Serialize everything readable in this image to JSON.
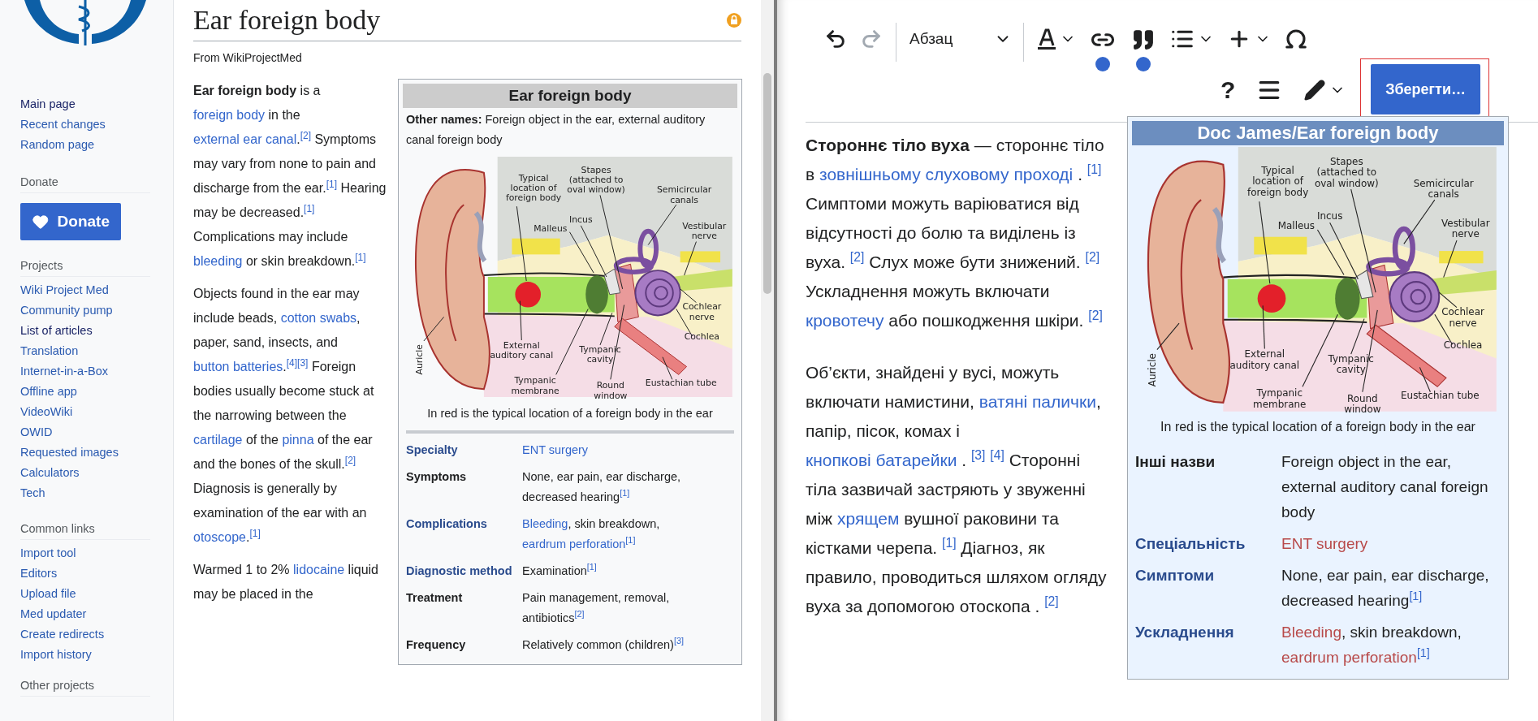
{
  "sidebar": {
    "main_links": [
      {
        "label": "Main page",
        "visited": true
      },
      {
        "label": "Recent changes",
        "visited": false
      },
      {
        "label": "Random page",
        "visited": false
      }
    ],
    "donate": {
      "heading": "Donate",
      "button": "Donate"
    },
    "sections": [
      {
        "heading": "Projects",
        "items": [
          {
            "label": "Wiki Project Med",
            "visited": false
          },
          {
            "label": "Community pump",
            "visited": false
          },
          {
            "label": "List of articles",
            "visited": true
          },
          {
            "label": "Translation",
            "visited": false
          },
          {
            "label": "Internet-in-a-Box",
            "visited": false
          },
          {
            "label": "Offline app",
            "visited": false
          },
          {
            "label": "VideoWiki",
            "visited": false
          },
          {
            "label": "OWID",
            "visited": false
          },
          {
            "label": "Requested images",
            "visited": false
          },
          {
            "label": "Calculators",
            "visited": false
          },
          {
            "label": "Tech",
            "visited": false
          }
        ]
      },
      {
        "heading": "Common links",
        "items": [
          {
            "label": "Import tool",
            "visited": false
          },
          {
            "label": "Editors",
            "visited": false
          },
          {
            "label": "Upload file",
            "visited": false
          },
          {
            "label": "Med updater",
            "visited": false
          },
          {
            "label": "Create redirects",
            "visited": false
          },
          {
            "label": "Import history",
            "visited": false
          }
        ]
      },
      {
        "heading": "Other projects"
      }
    ]
  },
  "article": {
    "title": "Ear foreign body",
    "subtitle": "From WikiProjectMed",
    "paragraphs": [
      [
        {
          "kind": "bold",
          "text": "Ear foreign body"
        },
        {
          "kind": "text",
          "text": " is a "
        },
        {
          "kind": "link",
          "text": "foreign body"
        },
        {
          "kind": "text",
          "text": " in the "
        },
        {
          "kind": "link",
          "text": "external ear canal"
        },
        {
          "kind": "text",
          "text": "."
        },
        {
          "kind": "ref",
          "text": "[2]"
        },
        {
          "kind": "text",
          "text": " Symptoms may vary from none to pain and discharge from the ear."
        },
        {
          "kind": "ref",
          "text": "[1]"
        },
        {
          "kind": "text",
          "text": " Hearing may be decreased."
        },
        {
          "kind": "ref",
          "text": "[1]"
        },
        {
          "kind": "text",
          "text": " Complications may include "
        },
        {
          "kind": "link",
          "text": "bleeding"
        },
        {
          "kind": "text",
          "text": " or skin breakdown."
        },
        {
          "kind": "ref",
          "text": "[1]"
        }
      ],
      [
        {
          "kind": "text",
          "text": "Objects found in the ear may include beads, "
        },
        {
          "kind": "link",
          "text": "cotton swabs"
        },
        {
          "kind": "text",
          "text": ", paper, sand, insects, and "
        },
        {
          "kind": "link",
          "text": "button batteries"
        },
        {
          "kind": "text",
          "text": "."
        },
        {
          "kind": "ref",
          "text": "[4]"
        },
        {
          "kind": "ref",
          "text": "[3]"
        },
        {
          "kind": "text",
          "text": " Foreign bodies usually become stuck at the narrowing between the "
        },
        {
          "kind": "link",
          "text": "cartilage"
        },
        {
          "kind": "text",
          "text": " of the "
        },
        {
          "kind": "link",
          "text": "pinna"
        },
        {
          "kind": "text",
          "text": " of the ear and the bones of the skull."
        },
        {
          "kind": "ref",
          "text": "[2]"
        },
        {
          "kind": "text",
          "text": " Diagnosis is generally by examination of the ear with an "
        },
        {
          "kind": "link",
          "text": "otoscope"
        },
        {
          "kind": "text",
          "text": "."
        },
        {
          "kind": "ref",
          "text": "[1]"
        }
      ],
      [
        {
          "kind": "text",
          "text": "Warmed 1 to 2% "
        },
        {
          "kind": "link",
          "text": "lidocaine"
        },
        {
          "kind": "text",
          "text": " liquid may be placed in the"
        }
      ]
    ],
    "infobox": {
      "title": "Ear foreign body",
      "other_names": {
        "label": "Other names:",
        "value": "Foreign object in the ear, external auditory canal foreign body"
      },
      "image": {
        "labels": [
          {
            "lines": [
              "Typical",
              "location of",
              "foreign body"
            ]
          },
          {
            "lines": [
              "Stapes",
              "(attached to",
              "oval window)"
            ]
          },
          {
            "lines": [
              "Semicircular",
              "canals"
            ]
          },
          {
            "lines": [
              "Incus"
            ]
          },
          {
            "lines": [
              "Malleus"
            ]
          },
          {
            "lines": [
              "Vestibular",
              "nerve"
            ]
          },
          {
            "lines": [
              "Cochlear",
              "nerve"
            ]
          },
          {
            "lines": [
              "Cochlea"
            ]
          },
          {
            "lines": [
              "External",
              "auditory canal"
            ]
          },
          {
            "lines": [
              "Tympanic",
              "cavity"
            ]
          },
          {
            "lines": [
              "Auricle"
            ]
          },
          {
            "lines": [
              "Tympanic",
              "membrane"
            ]
          },
          {
            "lines": [
              "Round",
              "window"
            ]
          },
          {
            "lines": [
              "Eustachian tube"
            ]
          }
        ]
      },
      "caption": "In red is the typical location of a foreign body in the ear",
      "rows": [
        {
          "label": "Specialty",
          "label_is_link": true,
          "value": [
            {
              "kind": "link",
              "text": "ENT surgery"
            }
          ]
        },
        {
          "label": "Symptoms",
          "label_is_link": false,
          "value": [
            {
              "kind": "text",
              "text": "None, ear pain, ear discharge, decreased hearing"
            },
            {
              "kind": "ref",
              "text": "[1]"
            }
          ]
        },
        {
          "label": "Complications",
          "label_is_link": true,
          "value": [
            {
              "kind": "link",
              "text": "Bleeding"
            },
            {
              "kind": "text",
              "text": ", skin breakdown, "
            },
            {
              "kind": "link",
              "text": "eardrum perforation"
            },
            {
              "kind": "ref",
              "text": "[1]"
            }
          ]
        },
        {
          "label": "Diagnostic method",
          "label_is_link": true,
          "value": [
            {
              "kind": "text",
              "text": "Examination"
            },
            {
              "kind": "ref",
              "text": "[1]"
            }
          ]
        },
        {
          "label": "Treatment",
          "label_is_link": false,
          "value": [
            {
              "kind": "text",
              "text": "Pain management, removal, antibiotics"
            },
            {
              "kind": "ref",
              "text": "[2]"
            }
          ]
        },
        {
          "label": "Frequency",
          "label_is_link": false,
          "value": [
            {
              "kind": "text",
              "text": "Relatively common (children)"
            },
            {
              "kind": "ref",
              "text": "[3]"
            }
          ]
        }
      ]
    }
  },
  "editor": {
    "toolbar": {
      "undo": {
        "disabled": false
      },
      "redo": {
        "disabled": true
      },
      "format": "Абзац",
      "help": "?",
      "save": "Зберегти…"
    },
    "paragraphs": [
      [
        {
          "kind": "bold",
          "text": "Стороннє тіло вуха"
        },
        {
          "kind": "text",
          "text": " — стороннє тіло в "
        },
        {
          "kind": "link",
          "text": "зовнішньому слуховому"
        },
        {
          "kind": "link",
          "text": "проході",
          "space_before": true
        },
        {
          "kind": "text",
          "text": " . "
        },
        {
          "kind": "ref",
          "text": "[1]"
        },
        {
          "kind": "text",
          "text": " Симптоми можуть варіюватися від відсутності до болю та виділень із вуха. "
        },
        {
          "kind": "ref",
          "text": "[2]"
        },
        {
          "kind": "text",
          "text": " Слух може бути знижений. "
        },
        {
          "kind": "ref",
          "text": "[2]"
        },
        {
          "kind": "text",
          "text": " Ускладнення можуть включати "
        },
        {
          "kind": "link",
          "text": "кровотечу"
        },
        {
          "kind": "text",
          "text": " або пошкодження шкіри. "
        },
        {
          "kind": "ref",
          "text": "[2]"
        }
      ],
      [
        {
          "kind": "text",
          "text": "Об’єкти, знайдені у вусі, можуть включати намистини, "
        },
        {
          "kind": "link",
          "text": "ватяні"
        },
        {
          "kind": "link",
          "text": "палички",
          "space_before": true
        },
        {
          "kind": "text",
          "text": ", папір, пісок, комах і "
        },
        {
          "kind": "link",
          "text": "кнопкові батарейки"
        },
        {
          "kind": "text",
          "text": " . "
        },
        {
          "kind": "ref",
          "text": "[3]"
        },
        {
          "kind": "ref",
          "text": "[4]",
          "space_before": true
        },
        {
          "kind": "text",
          "text": " Сторонні тіла зазвичай застряють у звуженні між "
        },
        {
          "kind": "link",
          "text": "хрящем"
        },
        {
          "kind": "text",
          "text": " вушної раковини та кістками черепа. "
        },
        {
          "kind": "ref",
          "text": "[1]"
        },
        {
          "kind": "text",
          "text": " Діагноз, як правило, проводиться шляхом огляду вуха за допомогою отоскопа . "
        },
        {
          "kind": "ref",
          "text": "[2]"
        }
      ]
    ],
    "infobox": {
      "title": "Doc James/Ear foreign body",
      "image": {
        "labels": [
          {
            "lines": [
              "Typical",
              "location of",
              "foreign body"
            ]
          },
          {
            "lines": [
              "Stapes",
              "(attached to",
              "oval window)"
            ]
          },
          {
            "lines": [
              "Semicircular",
              "canals"
            ]
          },
          {
            "lines": [
              "Incus"
            ]
          },
          {
            "lines": [
              "Malleus"
            ]
          },
          {
            "lines": [
              "Vestibular",
              "nerve"
            ]
          },
          {
            "lines": [
              "Cochlear",
              "nerve"
            ]
          },
          {
            "lines": [
              "Cochlea"
            ]
          },
          {
            "lines": [
              "External",
              "auditory canal"
            ]
          },
          {
            "lines": [
              "Tympanic",
              "cavity"
            ]
          },
          {
            "lines": [
              "Auricle"
            ]
          },
          {
            "lines": [
              "Tympanic",
              "membrane"
            ]
          },
          {
            "lines": [
              "Round",
              "window"
            ]
          },
          {
            "lines": [
              "Eustachian tube"
            ]
          }
        ]
      },
      "caption": "In red is the typical location of a foreign body in the ear",
      "rows": [
        {
          "label": "Інші назви",
          "label_is_link": false,
          "value": [
            {
              "kind": "text",
              "text": "Foreign object in the ear, external auditory canal foreign body"
            }
          ]
        },
        {
          "label": "Спеціальність",
          "label_is_link": true,
          "value": [
            {
              "kind": "redlink",
              "text": "ENT surgery"
            }
          ]
        },
        {
          "label": "Симптоми",
          "label_is_link": true,
          "value": [
            {
              "kind": "text",
              "text": "None, ear pain, ear discharge, decreased hearing"
            },
            {
              "kind": "ref",
              "text": "[1]"
            }
          ]
        },
        {
          "label": "Ускладнення",
          "label_is_link": true,
          "value": [
            {
              "kind": "redlink",
              "text": "Bleeding"
            },
            {
              "kind": "text",
              "text": ", skin breakdown, "
            },
            {
              "kind": "redlink",
              "text": "eardrum perforation"
            },
            {
              "kind": "ref",
              "text": "[1]"
            }
          ]
        }
      ]
    }
  }
}
